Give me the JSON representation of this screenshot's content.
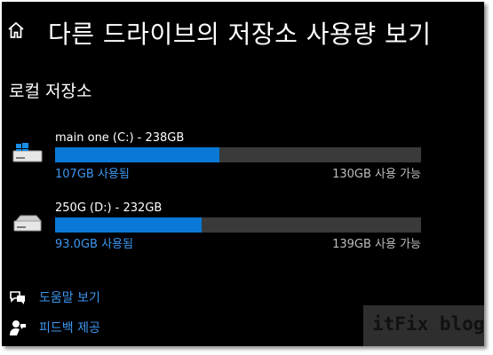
{
  "header": {
    "title": "다른 드라이브의 저장소 사용량 보기",
    "home_icon": "home-icon"
  },
  "section": {
    "title": "로컬 저장소"
  },
  "drives": [
    {
      "name": "main one (C:) - 238GB",
      "used": "107GB 사용됨",
      "free": "130GB 사용 가능",
      "used_fraction": 0.45,
      "icon": "windows-drive-icon"
    },
    {
      "name": "250G (D:) - 232GB",
      "used": "93.0GB 사용됨",
      "free": "139GB 사용 가능",
      "used_fraction": 0.4,
      "icon": "drive-icon"
    }
  ],
  "links": [
    {
      "label": "도움말 보기",
      "icon": "help-chat-icon"
    },
    {
      "label": "피드백 제공",
      "icon": "feedback-person-icon"
    }
  ],
  "watermark": {
    "text": "itFix blog"
  },
  "colors": {
    "background": "#000000",
    "accent": "#0a78d7",
    "link": "#3c96f0",
    "bar_track": "#3a3a3a",
    "free_text": "#bdbdbd"
  }
}
